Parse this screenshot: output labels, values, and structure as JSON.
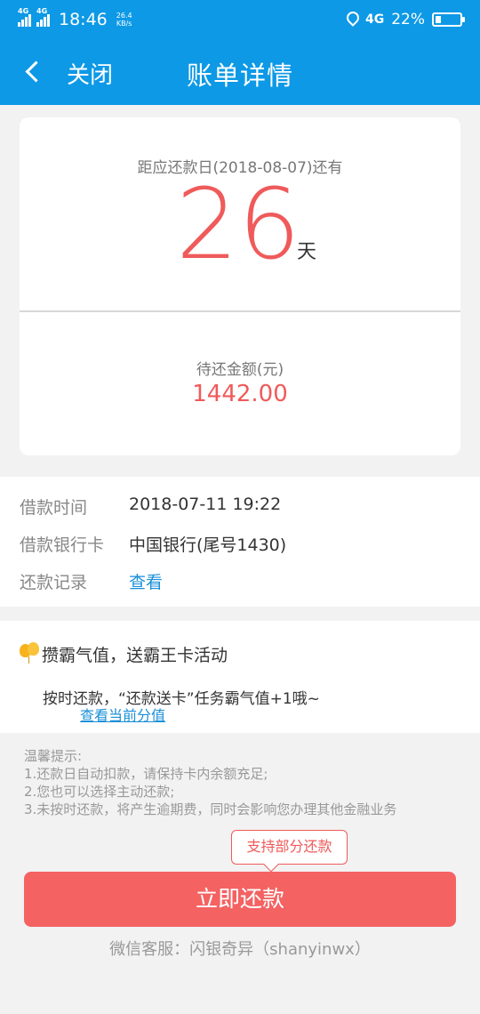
{
  "status_bar": {
    "net_left_1": "4G",
    "net_left_2": "4G",
    "time": "18:46",
    "speed_value": "26.4",
    "speed_unit": "KB/s",
    "net_right": "4G",
    "battery": "22%",
    "battery_level": 0.22
  },
  "nav": {
    "close_label": "关闭",
    "title": "账单详情"
  },
  "countdown": {
    "due_label": "距应还款日(2018-08-07)还有",
    "days": "26",
    "days_unit": "天",
    "amount_label": "待还金额(元)",
    "amount": "1442.00"
  },
  "info": {
    "rows": [
      {
        "key": "借款时间",
        "value": "2018-07-11 19:22"
      },
      {
        "key": "借款银行卡",
        "value": "中国银行(尾号1430)"
      },
      {
        "key": "还款记录",
        "value": "查看"
      }
    ]
  },
  "promo": {
    "title": "攒霸气值，送霸王卡活动",
    "desc": "按时还款，“还款送卡”任务霸气值+1哦~",
    "link": "查看当前分值"
  },
  "tips": {
    "title": "温馨提示:",
    "lines": [
      "1.还款日自动扣款，请保持卡内余额充足;",
      "2.您也可以选择主动还款;",
      "3.未按时还款，将产生逾期费，同时会影响您办理其他金融业务"
    ]
  },
  "tooltip": "支持部分还款",
  "repay_button": "立即还款",
  "service": "微信客服：闪银奇异（shanyinwx）",
  "colors": {
    "brand_blue": "#0d99e6",
    "accent_red": "#f05a5a",
    "link_blue": "#1a8fd8"
  }
}
